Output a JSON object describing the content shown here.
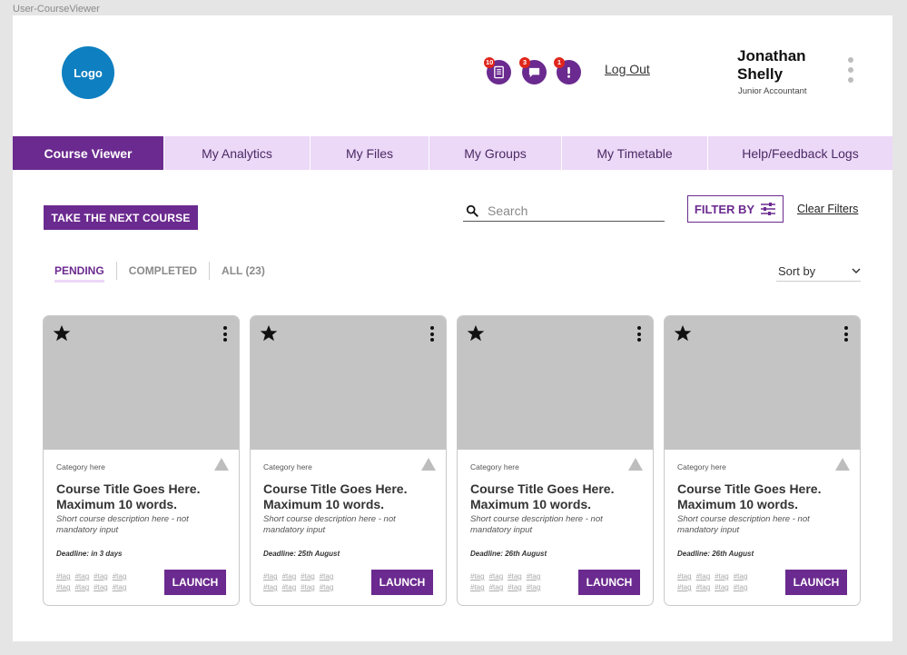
{
  "frame_label": "User-CourseViewer",
  "header": {
    "logo": "Logo",
    "icons": [
      {
        "name": "courses-icon",
        "badge": "10"
      },
      {
        "name": "messages-icon",
        "badge": "3"
      },
      {
        "name": "alerts-icon",
        "badge": "1"
      }
    ],
    "logout": "Log Out",
    "user_name": "Jonathan Shelly",
    "user_role": "Junior Accountant"
  },
  "nav": {
    "tabs": [
      {
        "label": "Course Viewer",
        "active": true
      },
      {
        "label": "My Analytics",
        "active": false
      },
      {
        "label": "My Files",
        "active": false
      },
      {
        "label": "My Groups",
        "active": false
      },
      {
        "label": "My Timetable",
        "active": false
      },
      {
        "label": "Help/Feedback Logs",
        "active": false
      }
    ]
  },
  "toolbar": {
    "next_course": "TAKE THE NEXT COURSE",
    "search_placeholder": "Search",
    "filter_by": "FILTER BY",
    "clear_filters": "Clear Filters"
  },
  "status_tabs": {
    "pending": "PENDING",
    "completed": "COMPLETED",
    "all": "ALL (23)"
  },
  "sort": {
    "label": "Sort by"
  },
  "cards": [
    {
      "category": "Category here",
      "title": "Course Title Goes Here. Maximum 10 words.",
      "description": "Short course description here - not mandatory input",
      "deadline": "Deadline: in 3 days",
      "tags": [
        "#tag",
        "#tag",
        "#tag",
        "#tag",
        "#tag",
        "#tag",
        "#tag",
        "#tag"
      ],
      "launch": "LAUNCH"
    },
    {
      "category": "Category here",
      "title": "Course Title Goes Here. Maximum 10 words.",
      "description": "Short course description here - not mandatory input",
      "deadline": "Deadline: 25th August",
      "tags": [
        "#tag",
        "#tag",
        "#tag",
        "#tag",
        "#tag",
        "#tag",
        "#tag",
        "#tag"
      ],
      "launch": "LAUNCH"
    },
    {
      "category": "Category here",
      "title": "Course Title Goes Here. Maximum 10 words.",
      "description": "Short course description here - not mandatory input",
      "deadline": "Deadline: 26th August",
      "tags": [
        "#tag",
        "#tag",
        "#tag",
        "#tag",
        "#tag",
        "#tag",
        "#tag",
        "#tag"
      ],
      "launch": "LAUNCH"
    },
    {
      "category": "Category here",
      "title": "Course Title Goes Here. Maximum 10 words.",
      "description": "Short course description here - not mandatory input",
      "deadline": "Deadline: 26th August",
      "tags": [
        "#tag",
        "#tag",
        "#tag",
        "#tag",
        "#tag",
        "#tag",
        "#tag",
        "#tag"
      ],
      "launch": "LAUNCH"
    }
  ],
  "colors": {
    "accent": "#6b2a8f",
    "accent_light": "#ecd8f7",
    "logo": "#0e7fc0",
    "badge": "#e0251b"
  }
}
